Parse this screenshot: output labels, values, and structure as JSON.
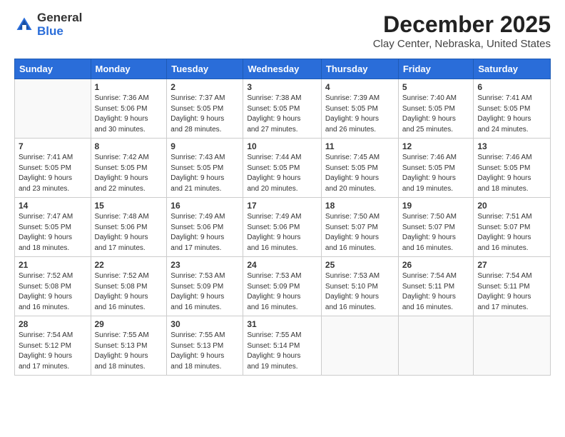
{
  "header": {
    "logo_line1": "General",
    "logo_line2": "Blue",
    "month_title": "December 2025",
    "location": "Clay Center, Nebraska, United States"
  },
  "days_of_week": [
    "Sunday",
    "Monday",
    "Tuesday",
    "Wednesday",
    "Thursday",
    "Friday",
    "Saturday"
  ],
  "weeks": [
    [
      {
        "day": "",
        "info": ""
      },
      {
        "day": "1",
        "info": "Sunrise: 7:36 AM\nSunset: 5:06 PM\nDaylight: 9 hours\nand 30 minutes."
      },
      {
        "day": "2",
        "info": "Sunrise: 7:37 AM\nSunset: 5:05 PM\nDaylight: 9 hours\nand 28 minutes."
      },
      {
        "day": "3",
        "info": "Sunrise: 7:38 AM\nSunset: 5:05 PM\nDaylight: 9 hours\nand 27 minutes."
      },
      {
        "day": "4",
        "info": "Sunrise: 7:39 AM\nSunset: 5:05 PM\nDaylight: 9 hours\nand 26 minutes."
      },
      {
        "day": "5",
        "info": "Sunrise: 7:40 AM\nSunset: 5:05 PM\nDaylight: 9 hours\nand 25 minutes."
      },
      {
        "day": "6",
        "info": "Sunrise: 7:41 AM\nSunset: 5:05 PM\nDaylight: 9 hours\nand 24 minutes."
      }
    ],
    [
      {
        "day": "7",
        "info": "Sunrise: 7:41 AM\nSunset: 5:05 PM\nDaylight: 9 hours\nand 23 minutes."
      },
      {
        "day": "8",
        "info": "Sunrise: 7:42 AM\nSunset: 5:05 PM\nDaylight: 9 hours\nand 22 minutes."
      },
      {
        "day": "9",
        "info": "Sunrise: 7:43 AM\nSunset: 5:05 PM\nDaylight: 9 hours\nand 21 minutes."
      },
      {
        "day": "10",
        "info": "Sunrise: 7:44 AM\nSunset: 5:05 PM\nDaylight: 9 hours\nand 20 minutes."
      },
      {
        "day": "11",
        "info": "Sunrise: 7:45 AM\nSunset: 5:05 PM\nDaylight: 9 hours\nand 20 minutes."
      },
      {
        "day": "12",
        "info": "Sunrise: 7:46 AM\nSunset: 5:05 PM\nDaylight: 9 hours\nand 19 minutes."
      },
      {
        "day": "13",
        "info": "Sunrise: 7:46 AM\nSunset: 5:05 PM\nDaylight: 9 hours\nand 18 minutes."
      }
    ],
    [
      {
        "day": "14",
        "info": "Sunrise: 7:47 AM\nSunset: 5:05 PM\nDaylight: 9 hours\nand 18 minutes."
      },
      {
        "day": "15",
        "info": "Sunrise: 7:48 AM\nSunset: 5:06 PM\nDaylight: 9 hours\nand 17 minutes."
      },
      {
        "day": "16",
        "info": "Sunrise: 7:49 AM\nSunset: 5:06 PM\nDaylight: 9 hours\nand 17 minutes."
      },
      {
        "day": "17",
        "info": "Sunrise: 7:49 AM\nSunset: 5:06 PM\nDaylight: 9 hours\nand 16 minutes."
      },
      {
        "day": "18",
        "info": "Sunrise: 7:50 AM\nSunset: 5:07 PM\nDaylight: 9 hours\nand 16 minutes."
      },
      {
        "day": "19",
        "info": "Sunrise: 7:50 AM\nSunset: 5:07 PM\nDaylight: 9 hours\nand 16 minutes."
      },
      {
        "day": "20",
        "info": "Sunrise: 7:51 AM\nSunset: 5:07 PM\nDaylight: 9 hours\nand 16 minutes."
      }
    ],
    [
      {
        "day": "21",
        "info": "Sunrise: 7:52 AM\nSunset: 5:08 PM\nDaylight: 9 hours\nand 16 minutes."
      },
      {
        "day": "22",
        "info": "Sunrise: 7:52 AM\nSunset: 5:08 PM\nDaylight: 9 hours\nand 16 minutes."
      },
      {
        "day": "23",
        "info": "Sunrise: 7:53 AM\nSunset: 5:09 PM\nDaylight: 9 hours\nand 16 minutes."
      },
      {
        "day": "24",
        "info": "Sunrise: 7:53 AM\nSunset: 5:09 PM\nDaylight: 9 hours\nand 16 minutes."
      },
      {
        "day": "25",
        "info": "Sunrise: 7:53 AM\nSunset: 5:10 PM\nDaylight: 9 hours\nand 16 minutes."
      },
      {
        "day": "26",
        "info": "Sunrise: 7:54 AM\nSunset: 5:11 PM\nDaylight: 9 hours\nand 16 minutes."
      },
      {
        "day": "27",
        "info": "Sunrise: 7:54 AM\nSunset: 5:11 PM\nDaylight: 9 hours\nand 17 minutes."
      }
    ],
    [
      {
        "day": "28",
        "info": "Sunrise: 7:54 AM\nSunset: 5:12 PM\nDaylight: 9 hours\nand 17 minutes."
      },
      {
        "day": "29",
        "info": "Sunrise: 7:55 AM\nSunset: 5:13 PM\nDaylight: 9 hours\nand 18 minutes."
      },
      {
        "day": "30",
        "info": "Sunrise: 7:55 AM\nSunset: 5:13 PM\nDaylight: 9 hours\nand 18 minutes."
      },
      {
        "day": "31",
        "info": "Sunrise: 7:55 AM\nSunset: 5:14 PM\nDaylight: 9 hours\nand 19 minutes."
      },
      {
        "day": "",
        "info": ""
      },
      {
        "day": "",
        "info": ""
      },
      {
        "day": "",
        "info": ""
      }
    ]
  ]
}
